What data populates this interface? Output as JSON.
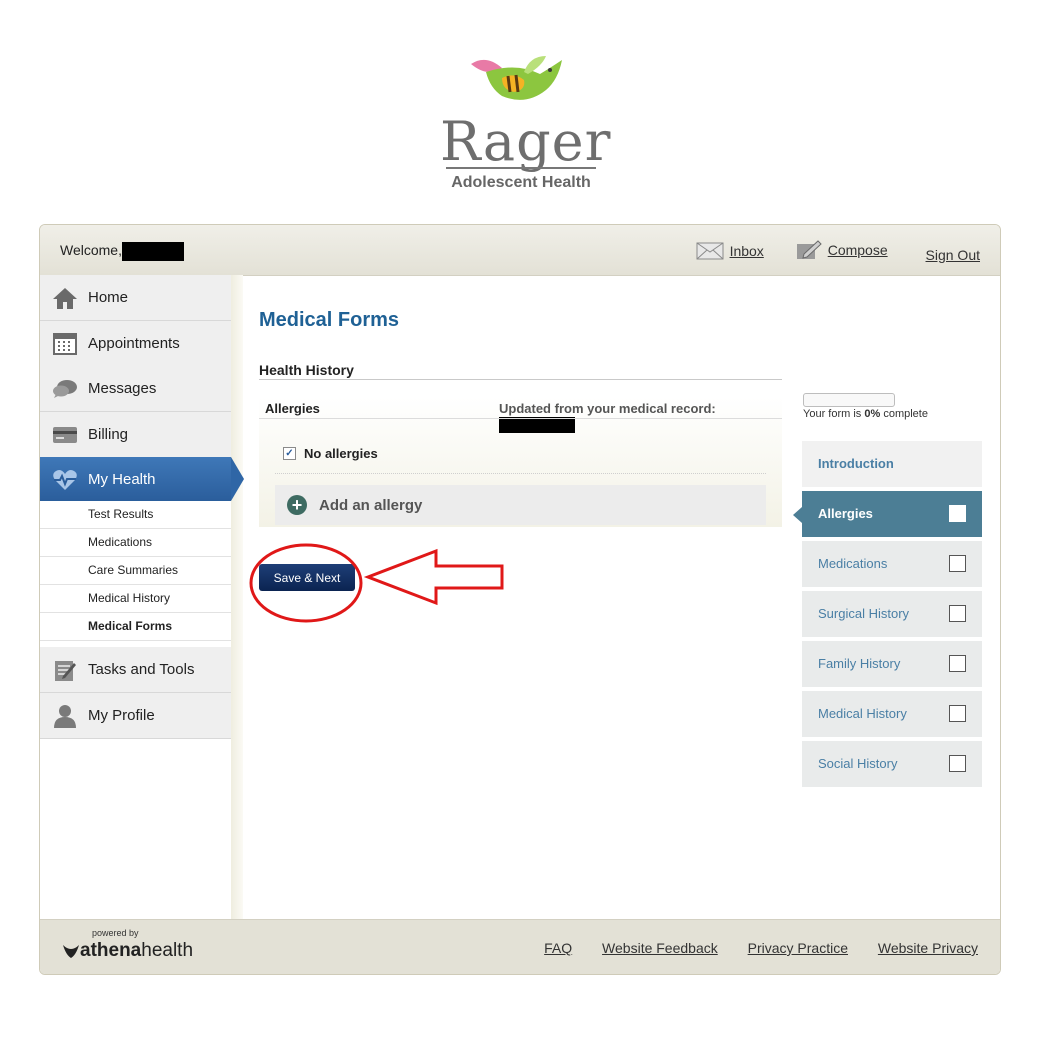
{
  "logo": {
    "brand": "Rager",
    "subtitle": "Adolescent Health"
  },
  "header": {
    "welcome": "Welcome,",
    "inbox": "Inbox",
    "compose": "Compose",
    "sign_out": "Sign Out"
  },
  "sidebar": {
    "items": [
      {
        "label": "Home",
        "icon": "home-icon"
      },
      {
        "label": "Appointments",
        "icon": "calendar-icon"
      },
      {
        "label": "Messages",
        "icon": "chat-icon"
      },
      {
        "label": "Billing",
        "icon": "credit-card-icon"
      },
      {
        "label": "My Health",
        "icon": "heart-pulse-icon",
        "active": true
      }
    ],
    "subitems": [
      "Test Results",
      "Medications",
      "Care Summaries",
      "Medical History",
      "Medical Forms"
    ],
    "items_after": [
      {
        "label": "Tasks and Tools",
        "icon": "notepad-icon"
      },
      {
        "label": "My Profile",
        "icon": "person-icon"
      }
    ]
  },
  "main": {
    "title": "Medical Forms",
    "section": "Health History",
    "allergies_label": "Allergies",
    "updated_text": "Updated from your medical record:",
    "no_allergies_label": "No allergies",
    "no_allergies_checked": true,
    "add_allergy_label": "Add an allergy",
    "save_button": "Save & Next"
  },
  "progress": {
    "prefix": "Your form is",
    "percent_text": "0%",
    "suffix": "complete",
    "value": 0
  },
  "steps": {
    "items": [
      "Introduction",
      "Allergies",
      "Medications",
      "Surgical History",
      "Family History",
      "Medical History",
      "Social History"
    ],
    "active": "Allergies"
  },
  "footer": {
    "powered_by": "powered by",
    "brand_a": "athena",
    "brand_b": "health",
    "links": [
      "FAQ",
      "Website Feedback",
      "Privacy Practice",
      "Website Privacy"
    ]
  },
  "colors": {
    "accent_blue": "#1f6195",
    "nav_active": "#2f66a6",
    "step_active": "#4c7e95",
    "annotation_red": "#e01818"
  }
}
